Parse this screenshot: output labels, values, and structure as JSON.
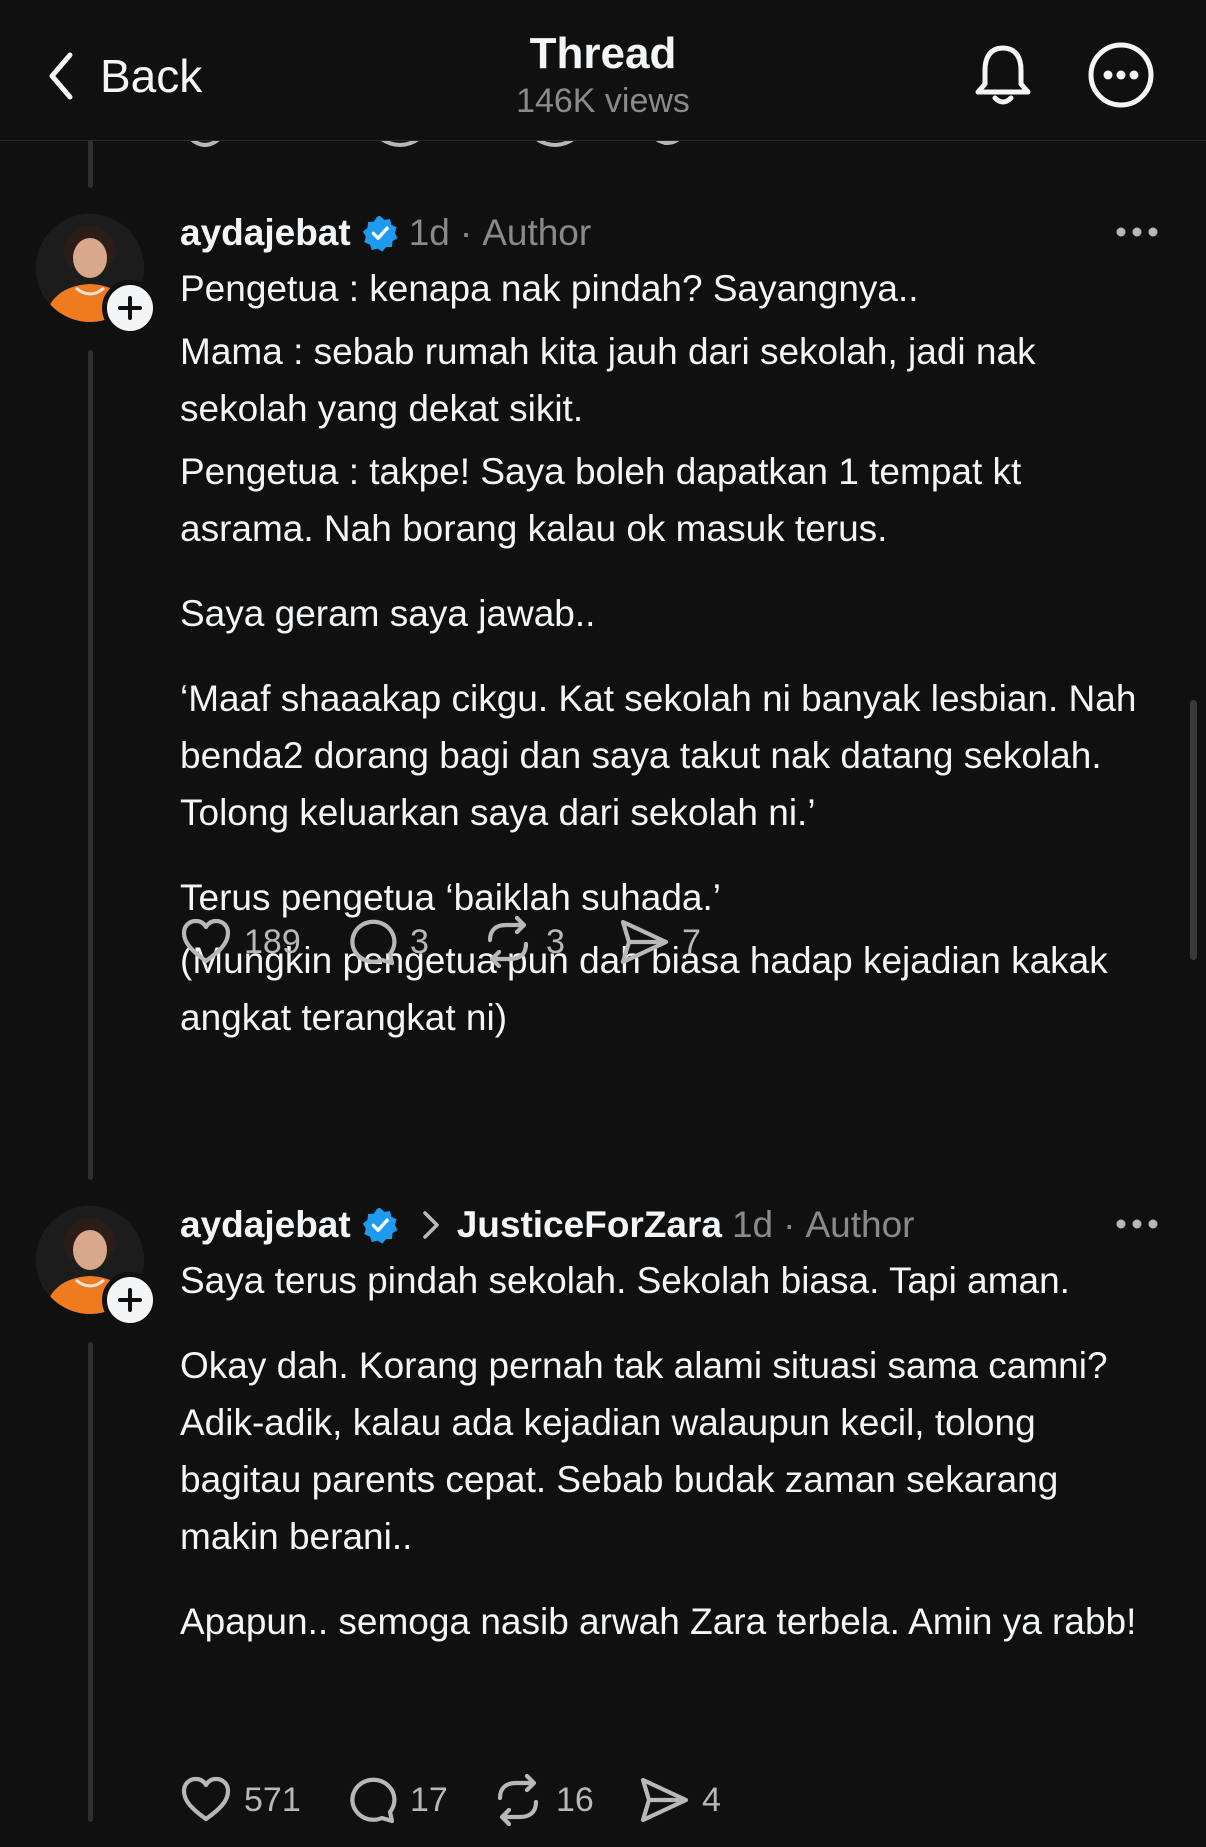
{
  "header": {
    "back_label": "Back",
    "title": "Thread",
    "views": "146K views",
    "bell_icon": "bell-icon",
    "more_icon": "more-circle-icon"
  },
  "posts": [
    {
      "username": "aydajebat",
      "verified": true,
      "reply_to": "",
      "time": "1d",
      "separator": "·",
      "role": "Author",
      "paragraphs": [
        "Pengetua : kenapa nak pindah? Sayangnya..",
        "Mama : sebab rumah kita jauh dari sekolah, jadi nak sekolah yang dekat sikit.",
        "Pengetua : takpe! Saya boleh dapatkan 1 tempat kt asrama. Nah borang kalau ok masuk terus.",
        "Saya geram saya jawab..",
        "‘Maaf shaaakap cikgu. Kat sekolah ni banyak lesbian. Nah benda2 dorang bagi dan saya takut nak datang sekolah. Tolong keluarkan saya dari sekolah ni.’",
        "Terus pengetua ‘baiklah suhada.’",
        "(Mungkin pengetua pun dah biasa hadap kejadian kakak angkat terangkat ni)"
      ],
      "likes": "189",
      "replies": "3",
      "reposts": "3",
      "shares": "7"
    },
    {
      "username": "aydajebat",
      "verified": true,
      "reply_to": "JusticeForZara",
      "time": "1d",
      "separator": "·",
      "role": "Author",
      "paragraphs": [
        "Saya terus pindah sekolah. Sekolah biasa. Tapi aman.",
        "Okay dah. Korang pernah tak alami situasi sama camni? Adik-adik, kalau ada kejadian walaupun kecil, tolong bagitau parents cepat. Sebab budak zaman sekarang makin berani..",
        "Apapun.. semoga nasib arwah Zara terbela. Amin ya rabb!"
      ],
      "likes": "571",
      "replies": "17",
      "reposts": "16",
      "shares": "4"
    }
  ],
  "colors": {
    "background": "#101010",
    "text": "#f3f5f7",
    "muted": "#8a8a8a",
    "verified": "#1d9bf0",
    "thread_line": "#2f2f2f"
  }
}
